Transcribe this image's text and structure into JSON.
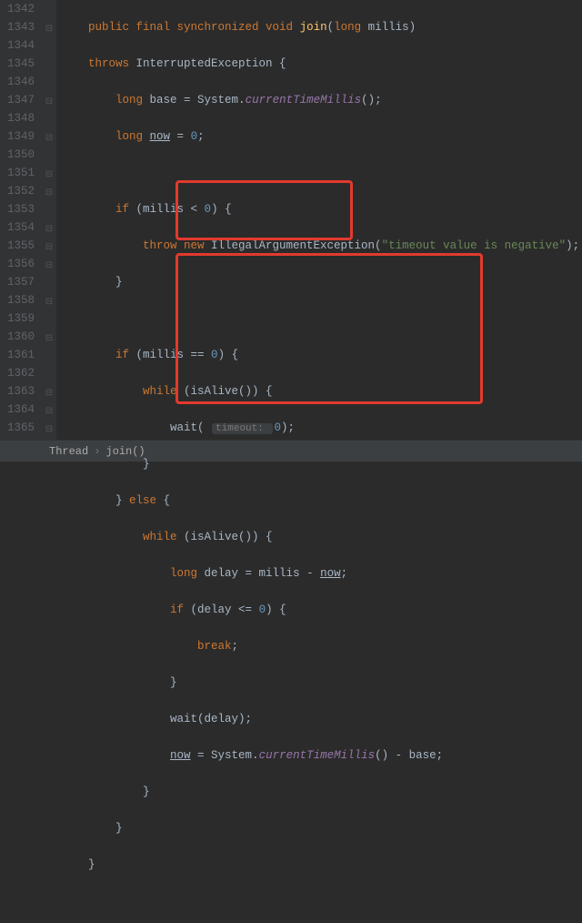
{
  "gutter": {
    "start": 1342,
    "end": 1365
  },
  "breadcrumb": {
    "item1": "Thread",
    "sep": "›",
    "item2": "join()"
  },
  "code": {
    "l1342": {
      "kw1": "public final synchronized void ",
      "fn": "join",
      "rest": "(",
      "kw2": "long ",
      "p": "millis",
      "close": ")"
    },
    "l1343": {
      "kw": "throws ",
      "ex": "InterruptedException {"
    },
    "l1344": {
      "kw": "long ",
      "v": "base = System.",
      "m": "currentTimeMillis",
      "t": "();"
    },
    "l1345": {
      "kw": "long ",
      "v": "now",
      "eq": " = ",
      "n": "0",
      "sc": ";"
    },
    "l1347": {
      "kw": "if ",
      "c": "(millis < ",
      "n": "0",
      "r": ") {"
    },
    "l1348": {
      "kw": "throw new ",
      "ex": "IllegalArgumentException(",
      "s": "\"timeout value is negative\"",
      "r": ");"
    },
    "l1349": {
      "b": "}"
    },
    "l1351": {
      "kw": "if ",
      "c": "(millis == ",
      "n": "0",
      "r": ") {"
    },
    "l1352": {
      "kw": "while ",
      "c": "(isAlive()) {"
    },
    "l1353": {
      "fn": "wait( ",
      "hint": "timeout: ",
      "n": "0",
      "r": ");"
    },
    "l1354": {
      "b": "}"
    },
    "l1355": {
      "b1": "} ",
      "kw": "else ",
      "b2": "{"
    },
    "l1356": {
      "kw": "while ",
      "c": "(isAlive()) {"
    },
    "l1357": {
      "kw": "long ",
      "v": "delay = millis - ",
      "u": "now",
      "sc": ";"
    },
    "l1358": {
      "kw": "if ",
      "c": "(delay <= ",
      "n": "0",
      "r": ") {"
    },
    "l1359": {
      "kw": "break",
      "sc": ";"
    },
    "l1360": {
      "b": "}"
    },
    "l1361": {
      "fn": "wait(delay);"
    },
    "l1362": {
      "u": "now",
      "v": " = System.",
      "m": "currentTimeMillis",
      "r": "() - base;"
    },
    "l1363": {
      "b": "}"
    },
    "l1364": {
      "b": "}"
    },
    "l1365": {
      "b": "}"
    }
  }
}
